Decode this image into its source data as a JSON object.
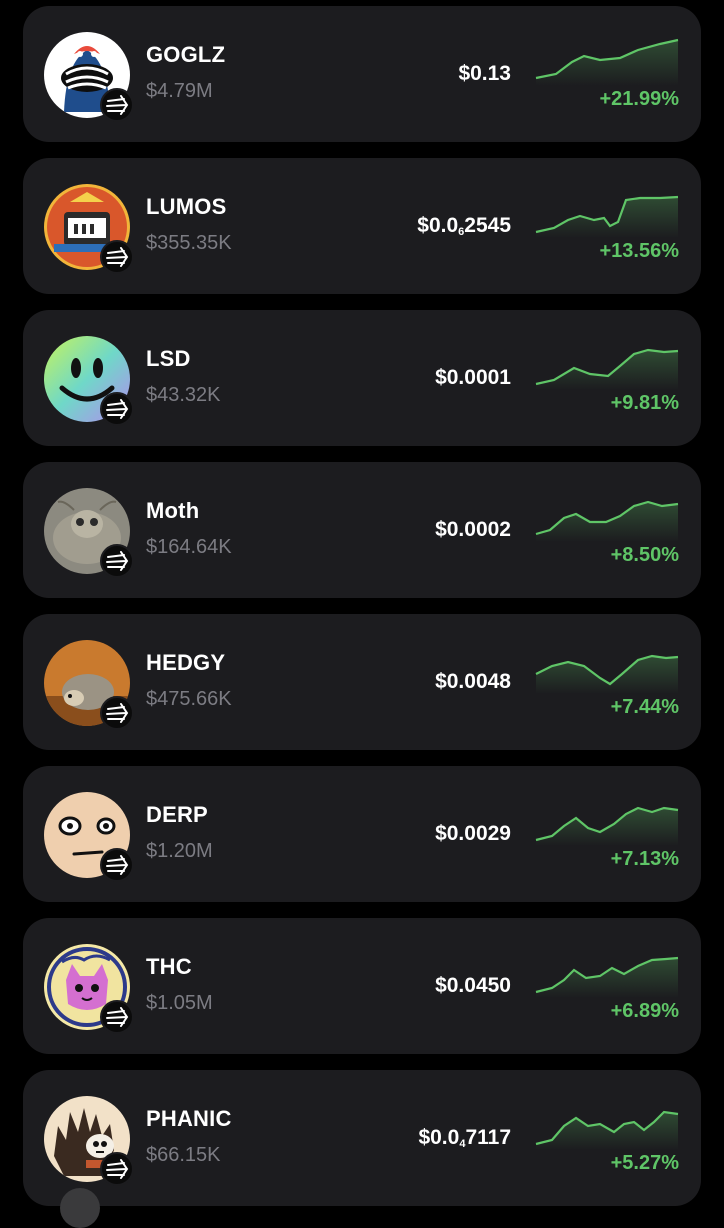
{
  "accent_up": "#5fc567",
  "tokens": [
    {
      "name": "GOGLZ",
      "mcap": "$4.79M",
      "price_main": "$0.13",
      "price_sub": "",
      "price_tail": "",
      "change": "+21.99%",
      "icon": "goglz-icon",
      "chain_icon": "sonic-chain-icon"
    },
    {
      "name": "LUMOS",
      "mcap": "$355.35K",
      "price_main": "$0.0",
      "price_sub": "6",
      "price_tail": "2545",
      "change": "+13.56%",
      "icon": "lumos-icon",
      "chain_icon": "sonic-chain-icon"
    },
    {
      "name": "LSD",
      "mcap": "$43.32K",
      "price_main": "$0.0001",
      "price_sub": "",
      "price_tail": "",
      "change": "+9.81%",
      "icon": "lsd-smiley-icon",
      "chain_icon": "sonic-chain-icon"
    },
    {
      "name": "Moth",
      "mcap": "$164.64K",
      "price_main": "$0.0002",
      "price_sub": "",
      "price_tail": "",
      "change": "+8.50%",
      "icon": "moth-icon",
      "chain_icon": "sonic-chain-icon"
    },
    {
      "name": "HEDGY",
      "mcap": "$475.66K",
      "price_main": "$0.0048",
      "price_sub": "",
      "price_tail": "",
      "change": "+7.44%",
      "icon": "hedgehog-icon",
      "chain_icon": "sonic-chain-icon"
    },
    {
      "name": "DERP",
      "mcap": "$1.20M",
      "price_main": "$0.0029",
      "price_sub": "",
      "price_tail": "",
      "change": "+7.13%",
      "icon": "derp-face-icon",
      "chain_icon": "sonic-chain-icon"
    },
    {
      "name": "THC",
      "mcap": "$1.05M",
      "price_main": "$0.0450",
      "price_sub": "",
      "price_tail": "",
      "change": "+6.89%",
      "icon": "thc-cat-icon",
      "chain_icon": "sonic-chain-icon"
    },
    {
      "name": "PHANIC",
      "mcap": "$66.15K",
      "price_main": "$0.0",
      "price_sub": "4",
      "price_tail": "7117",
      "change": "+5.27%",
      "icon": "phanic-icon",
      "chain_icon": "sonic-chain-icon"
    }
  ]
}
